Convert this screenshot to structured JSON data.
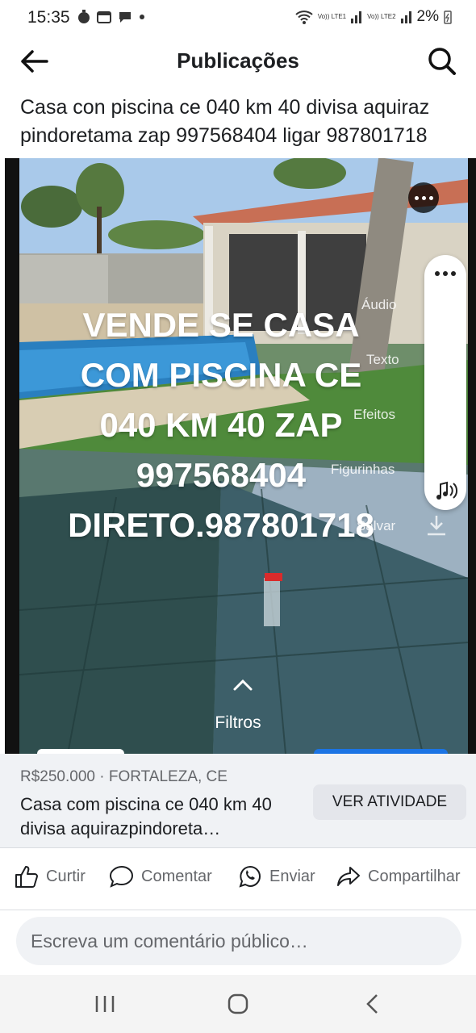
{
  "status": {
    "time": "15:35",
    "carrier1": "Vo)) LTE1",
    "carrier2": "Vo)) LTE2",
    "battery": "2%"
  },
  "header": {
    "title": "Publicações"
  },
  "post": {
    "text": "Casa con piscina ce 040 km 40 divisa aquiraz pindoretama zap 997568404 ligar 987801718"
  },
  "media": {
    "overlay_lines": [
      "VENDE SE CASA",
      "COM PISCINA CE",
      "040 KM 40 ZAP",
      "997568404",
      "DIRETO.987801718"
    ],
    "side_labels": [
      "Áudio",
      "Texto",
      "Efeitos",
      "Figurinhas",
      "Salvar"
    ],
    "filters_label": "Filtros"
  },
  "listing": {
    "price_location": "R$250.000 · FORTALEZA, CE",
    "title": "Casa com piscina ce 040 km 40 divisa aquirazpindoreta…",
    "button_label": "VER ATIVIDADE"
  },
  "actions": {
    "like": "Curtir",
    "comment": "Comentar",
    "send": "Enviar",
    "share": "Compartilhar"
  },
  "comment": {
    "placeholder": "Escreva um comentário público…"
  },
  "colors": {
    "accent": "#1b74e4",
    "text": "#1c1e21",
    "muted": "#65676b",
    "surface": "#f0f2f5"
  }
}
